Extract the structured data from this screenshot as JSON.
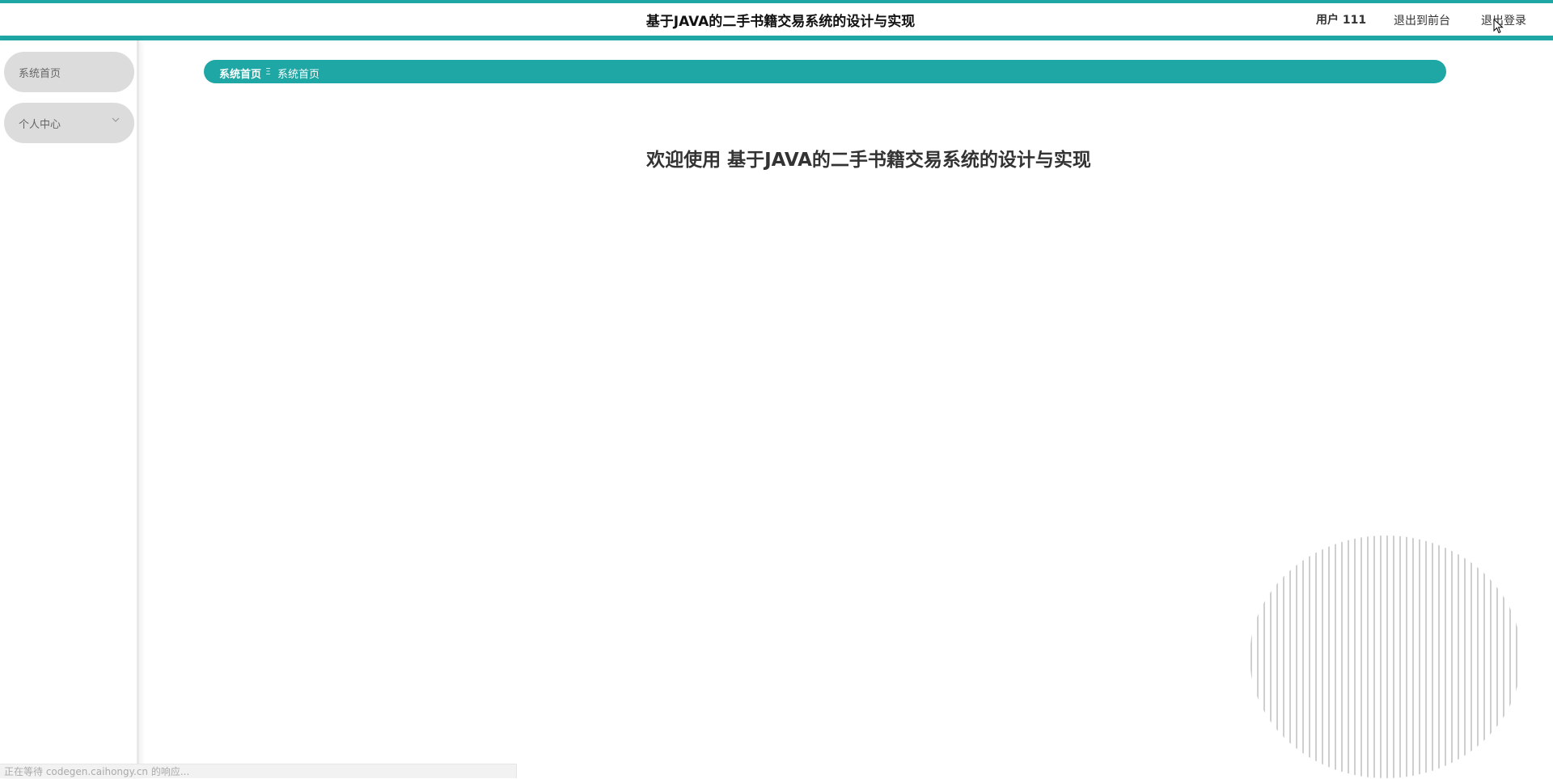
{
  "header": {
    "title": "基于JAVA的二手书籍交易系统的设计与实现",
    "user_label": "用户 111",
    "link_front": "退出到前台",
    "link_logout": "退出登录"
  },
  "sidebar": {
    "items": [
      {
        "label": "系统首页"
      },
      {
        "label": "个人中心"
      }
    ]
  },
  "breadcrumb": {
    "items": [
      "系统首页",
      "系统首页"
    ],
    "separator": "Ξ"
  },
  "main": {
    "welcome": "欢迎使用 基于JAVA的二手书籍交易系统的设计与实现"
  },
  "status": {
    "text": "正在等待 codegen.caihongy.cn 的响应..."
  },
  "colors": {
    "accent": "#1ea7a4",
    "menu_bg": "#dcdcdc"
  }
}
